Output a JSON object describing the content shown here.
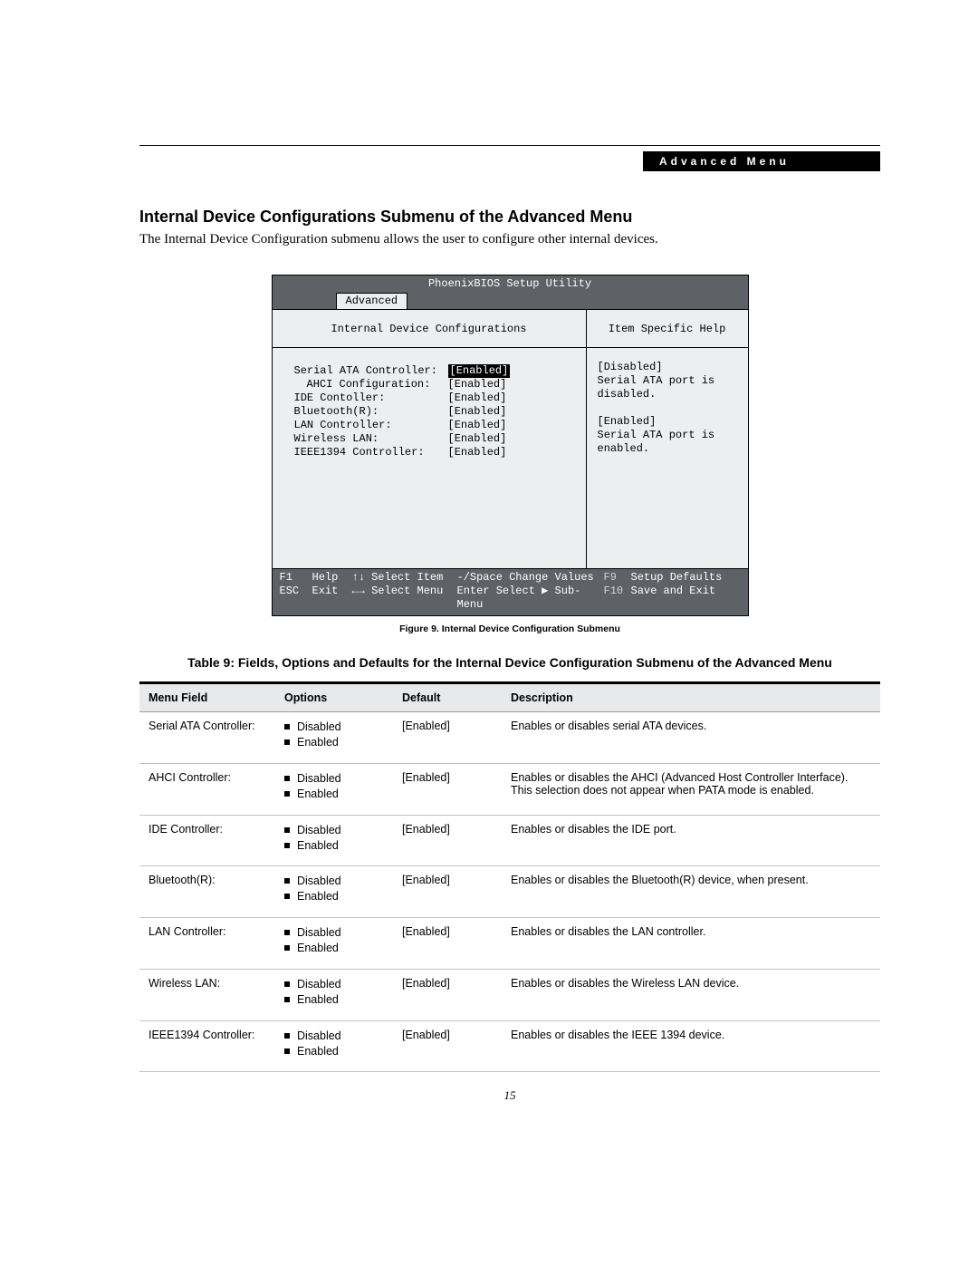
{
  "header_chip": "Advanced Menu",
  "section_title": "Internal Device Configurations Submenu of the Advanced Menu",
  "intro": "The Internal Device Configuration submenu allows the user to configure other internal devices.",
  "bios": {
    "utility_title": "PhoenixBIOS Setup Utility",
    "tab": "Advanced",
    "left_title": "Internal Device Configurations",
    "right_title": "Item Specific Help",
    "settings": [
      {
        "label": "Serial ATA Controller:",
        "value": "Enabled]",
        "highlight": true,
        "indent": false
      },
      {
        "label": "AHCI Configuration:",
        "value": "[Enabled]",
        "highlight": false,
        "indent": true
      },
      {
        "label": "IDE Contoller:",
        "value": "[Enabled]",
        "highlight": false,
        "indent": false
      },
      {
        "label": "Bluetooth(R):",
        "value": "[Enabled]",
        "highlight": false,
        "indent": false
      },
      {
        "label": "LAN Controller:",
        "value": "[Enabled]",
        "highlight": false,
        "indent": false
      },
      {
        "label": "Wireless LAN:",
        "value": "[Enabled]",
        "highlight": false,
        "indent": false
      },
      {
        "label": "IEEE1394 Controller:",
        "value": "[Enabled]",
        "highlight": false,
        "indent": false
      }
    ],
    "help_text": "[Disabled]\nSerial ATA port is disabled.\n\n[Enabled]\nSerial ATA port is enabled.",
    "footer": {
      "row1": {
        "k1": "F1",
        "l1": "Help",
        "arrows": "↑↓ Select Item",
        "mid": "-/Space Change Values",
        "fk": "F9",
        "action": "Setup Defaults"
      },
      "row2": {
        "k1": "ESC",
        "l1": "Exit",
        "arrows": "←→ Select Menu",
        "mid": "Enter Select ▶ Sub-Menu",
        "fk": "F10",
        "action": "Save and Exit"
      }
    }
  },
  "figure_caption": "Figure 9.   Internal Device Configuration Submenu",
  "table_title": "Table 9: Fields, Options and Defaults for the Internal Device Configuration Submenu of the Advanced Menu",
  "table": {
    "headers": {
      "mf": "Menu Field",
      "opt": "Options",
      "def": "Default",
      "desc": "Description"
    },
    "rows": [
      {
        "mf": "Serial ATA Controller:",
        "opts": [
          "Disabled",
          "Enabled"
        ],
        "def": "[Enabled]",
        "desc": "Enables or disables serial ATA devices."
      },
      {
        "mf": "AHCI Controller:",
        "opts": [
          "Disabled",
          "Enabled"
        ],
        "def": "[Enabled]",
        "desc": "Enables or disables the AHCI (Advanced Host Controller Interface). This selection does not appear when PATA mode is enabled."
      },
      {
        "mf": "IDE Controller:",
        "opts": [
          "Disabled",
          "Enabled"
        ],
        "def": "[Enabled]",
        "desc": "Enables or disables the IDE port."
      },
      {
        "mf": "Bluetooth(R):",
        "opts": [
          "Disabled",
          "Enabled"
        ],
        "def": "[Enabled]",
        "desc": "Enables or disables the Bluetooth(R) device, when present."
      },
      {
        "mf": "LAN Controller:",
        "opts": [
          "Disabled",
          "Enabled"
        ],
        "def": "[Enabled]",
        "desc": "Enables or disables the LAN controller."
      },
      {
        "mf": "Wireless LAN:",
        "opts": [
          "Disabled",
          "Enabled"
        ],
        "def": "[Enabled]",
        "desc": "Enables or disables the Wireless LAN device."
      },
      {
        "mf": "IEEE1394 Controller:",
        "opts": [
          "Disabled",
          "Enabled"
        ],
        "def": "[Enabled]",
        "desc": "Enables or disables the IEEE 1394 device."
      }
    ]
  },
  "page_number": "15"
}
